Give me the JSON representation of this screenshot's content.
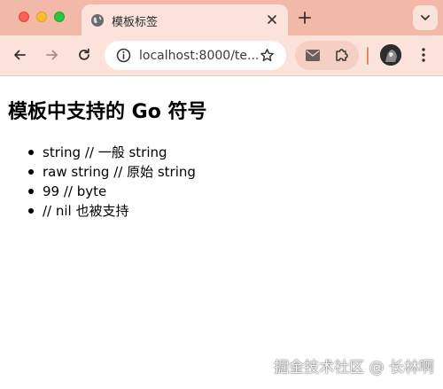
{
  "browser": {
    "tab": {
      "title": "模板标签"
    },
    "address_bar": {
      "url": "localhost:8000/te..."
    }
  },
  "page": {
    "heading": "模板中支持的 Go 符号",
    "items": [
      "string // 一般 string",
      "raw string // 原始 string",
      "99 // byte",
      "// nil 也被支持"
    ]
  },
  "watermark": "掘金技术社区 @ 长林啊",
  "colors": {
    "tabbar_bg": "#f2b8a8",
    "toolbar_bg": "#fbe3db",
    "accent_divider": "#e08a70"
  }
}
